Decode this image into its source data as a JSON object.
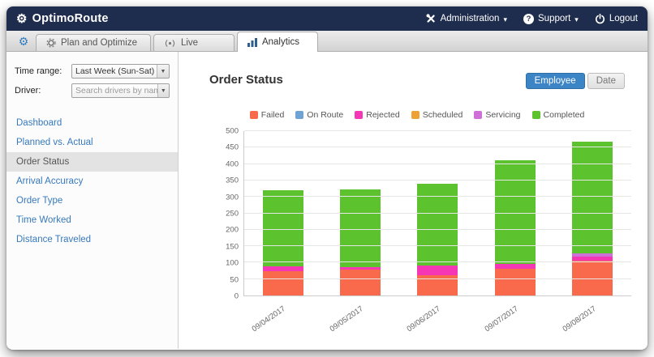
{
  "app": {
    "brand": "OptimoRoute"
  },
  "topbar": {
    "administration_label": "Administration",
    "support_label": "Support",
    "logout_label": "Logout",
    "caret": "▾"
  },
  "tabs": [
    {
      "label": "Plan and Optimize"
    },
    {
      "label": "Live"
    },
    {
      "label": "Analytics",
      "active": true
    }
  ],
  "sidebar": {
    "time_range_label": "Time range:",
    "time_range_value": "Last Week (Sun-Sat)",
    "driver_label": "Driver:",
    "driver_placeholder": "Search drivers by nam",
    "items": [
      {
        "label": "Dashboard",
        "active": false
      },
      {
        "label": "Planned vs. Actual",
        "active": false
      },
      {
        "label": "Order Status",
        "active": true
      },
      {
        "label": "Arrival Accuracy",
        "active": false
      },
      {
        "label": "Order Type",
        "active": false
      },
      {
        "label": "Time Worked",
        "active": false
      },
      {
        "label": "Distance Traveled",
        "active": false
      }
    ]
  },
  "main": {
    "title": "Order Status",
    "toggle_employee": "Employee",
    "toggle_date": "Date"
  },
  "colors": {
    "topbar_bg": "#1e2c4e",
    "accent_blue": "#3b85c6",
    "link_blue": "#3779bd"
  },
  "chart_data": {
    "type": "bar",
    "stacked": true,
    "title": "Order Status",
    "categories": [
      "09/04/2017",
      "09/05/2017",
      "09/06/2017",
      "09/07/2017",
      "09/08/2017"
    ],
    "series": [
      {
        "name": "Failed",
        "color": "#f96a4c",
        "values": [
          75,
          78,
          62,
          82,
          105
        ]
      },
      {
        "name": "On Route",
        "color": "#6fa3d4",
        "values": [
          0,
          0,
          0,
          0,
          0
        ]
      },
      {
        "name": "Rejected",
        "color": "#f537b5",
        "values": [
          13,
          8,
          28,
          15,
          14
        ]
      },
      {
        "name": "Scheduled",
        "color": "#eea236",
        "values": [
          0,
          0,
          0,
          0,
          0
        ]
      },
      {
        "name": "Servicing",
        "color": "#cf6fd8",
        "values": [
          0,
          0,
          0,
          0,
          8
        ]
      },
      {
        "name": "Completed",
        "color": "#5cc32e",
        "values": [
          232,
          236,
          250,
          315,
          340
        ]
      }
    ],
    "ylim": [
      0,
      500
    ],
    "ytick": 50,
    "grid": true,
    "legend_position": "top"
  }
}
